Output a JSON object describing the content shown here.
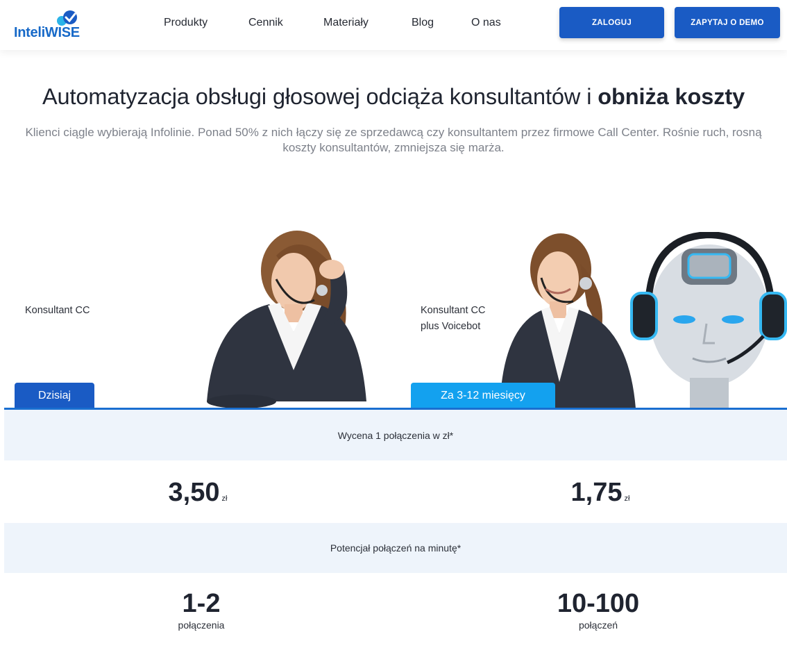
{
  "brand": {
    "logo_text": "InteliWISE"
  },
  "nav": {
    "items": [
      "Produkty",
      "Cennik",
      "Materiały",
      "Blog",
      "O nas"
    ],
    "login_label": "ZALOGUJ",
    "demo_label": "ZAPYTAJ O DEMO"
  },
  "hero": {
    "title_regular": "Automatyzacja obsługi głosowej odciąża konsultantów i ",
    "title_bold": "obniża koszty",
    "subtitle": "Klienci ciągle wybierają Infolinie. Ponad 50% z nich łączy się ze sprzedawcą czy konsultantem przez firmowe Call Center. Rośnie ruch, rosną koszty konsultantów, zmniejsza się marża.",
    "left_label": "Konsultant CC",
    "right_label_line1": "Konsultant CC",
    "right_label_line2": "plus Voicebot",
    "tab_today": "Dzisiaj",
    "tab_future": "Za 3-12 miesięcy"
  },
  "comparison": {
    "price_header": "Wycena 1 połączenia w zł*",
    "price_today": "3,50",
    "price_future": "1,75",
    "currency": "zł",
    "capacity_header": "Potencjał połączeń na minutę*",
    "capacity_today": "1-2",
    "capacity_today_unit": "połączenia",
    "capacity_future": "10-100",
    "capacity_future_unit": "połączeń"
  },
  "colors": {
    "primary": "#1a5bc4",
    "accent": "#13a1ef",
    "band": "#eef4fb"
  }
}
